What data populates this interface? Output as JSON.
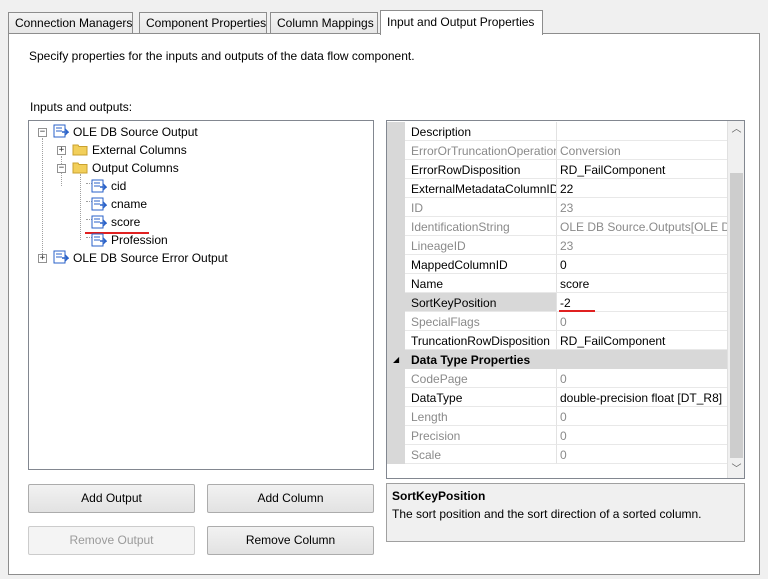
{
  "tabs": [
    {
      "label": "Connection Managers",
      "active": false
    },
    {
      "label": "Component Properties",
      "active": false
    },
    {
      "label": "Column Mappings",
      "active": false
    },
    {
      "label": "Input and Output Properties",
      "active": true
    }
  ],
  "description": "Specify properties for the inputs and outputs of the data flow component.",
  "io_label": "Inputs and outputs:",
  "tree": {
    "source_output": "OLE DB Source Output",
    "external_columns": "External Columns",
    "output_columns": "Output Columns",
    "columns": [
      "cid",
      "cname",
      "score",
      "Profession"
    ],
    "error_output": "OLE DB Source Error Output"
  },
  "properties": [
    {
      "name": "Description",
      "value": "",
      "readonly": false
    },
    {
      "name": "ErrorOrTruncationOperation",
      "value": "Conversion",
      "readonly": true
    },
    {
      "name": "ErrorRowDisposition",
      "value": "RD_FailComponent",
      "readonly": false
    },
    {
      "name": "ExternalMetadataColumnID",
      "value": "22",
      "readonly": false
    },
    {
      "name": "ID",
      "value": "23",
      "readonly": true
    },
    {
      "name": "IdentificationString",
      "value": "OLE DB Source.Outputs[OLE DB",
      "readonly": true
    },
    {
      "name": "LineageID",
      "value": "23",
      "readonly": true
    },
    {
      "name": "MappedColumnID",
      "value": "0",
      "readonly": false
    },
    {
      "name": "Name",
      "value": "score",
      "readonly": false
    },
    {
      "name": "SortKeyPosition",
      "value": "-2",
      "readonly": false
    },
    {
      "name": "SpecialFlags",
      "value": "0",
      "readonly": true
    },
    {
      "name": "TruncationRowDisposition",
      "value": "RD_FailComponent",
      "readonly": false
    }
  ],
  "category": "Data Type Properties",
  "type_properties": [
    {
      "name": "CodePage",
      "value": "0",
      "readonly": true
    },
    {
      "name": "DataType",
      "value": "double-precision float [DT_R8]",
      "readonly": false
    },
    {
      "name": "Length",
      "value": "0",
      "readonly": true
    },
    {
      "name": "Precision",
      "value": "0",
      "readonly": true
    },
    {
      "name": "Scale",
      "value": "0",
      "readonly": true
    }
  ],
  "help": {
    "title": "SortKeyPosition",
    "body": "The sort position and the sort direction of a sorted column."
  },
  "buttons": {
    "add_output": "Add Output",
    "add_column": "Add Column",
    "remove_output": "Remove Output",
    "remove_column": "Remove Column"
  },
  "colors": {
    "annotation_red": "#e02020",
    "readonly_text": "#8a8a8a",
    "column_icon_blue": "#2a62c9",
    "folder_yellow": "#f2cf5a"
  }
}
